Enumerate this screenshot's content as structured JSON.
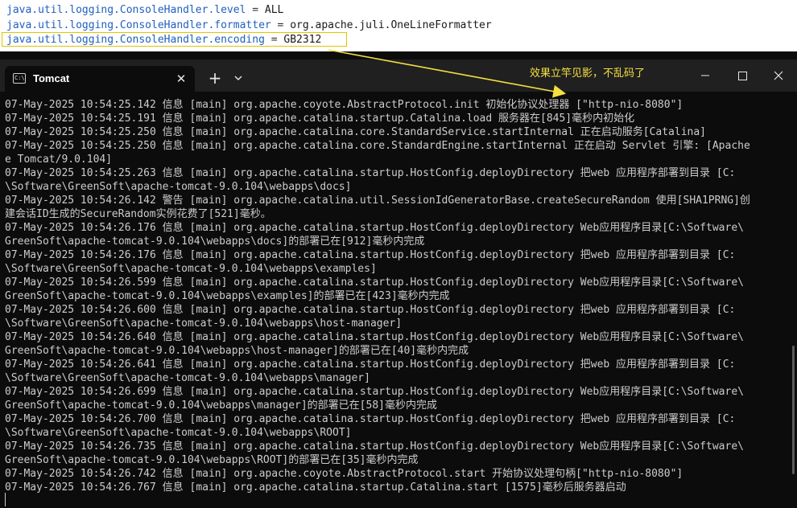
{
  "config_lines": [
    {
      "key": "java.util.logging.ConsoleHandler.level",
      "op": " = ",
      "value": "ALL"
    },
    {
      "key": "java.util.logging.ConsoleHandler.formatter",
      "op": " = ",
      "value": "org.apache.juli.OneLineFormatter"
    },
    {
      "key": "java.util.logging.ConsoleHandler.encoding",
      "op": " = ",
      "value": "GB2312"
    }
  ],
  "annotation": {
    "text": "效果立竿见影，不乱码了",
    "color": "#f5e040"
  },
  "tab": {
    "title": "Tomcat",
    "icon": "terminal-icon",
    "icon_label": "C:\\"
  },
  "window_buttons": [
    "minimize-icon",
    "maximize-icon",
    "close-icon"
  ],
  "console_lines": [
    "07-May-2025 10:54:25.142 信息 [main] org.apache.coyote.AbstractProtocol.init 初始化协议处理器 [\"http-nio-8080\"]",
    "07-May-2025 10:54:25.191 信息 [main] org.apache.catalina.startup.Catalina.load 服务器在[845]毫秒内初始化",
    "07-May-2025 10:54:25.250 信息 [main] org.apache.catalina.core.StandardService.startInternal 正在启动服务[Catalina]",
    "07-May-2025 10:54:25.250 信息 [main] org.apache.catalina.core.StandardEngine.startInternal 正在启动 Servlet 引擎: [Apache",
    "e Tomcat/9.0.104]",
    "07-May-2025 10:54:25.263 信息 [main] org.apache.catalina.startup.HostConfig.deployDirectory 把web 应用程序部署到目录 [C:",
    "\\Software\\GreenSoft\\apache-tomcat-9.0.104\\webapps\\docs]",
    "07-May-2025 10:54:26.142 警告 [main] org.apache.catalina.util.SessionIdGeneratorBase.createSecureRandom 使用[SHA1PRNG]创",
    "建会话ID生成的SecureRandom实例花费了[521]毫秒。",
    "07-May-2025 10:54:26.176 信息 [main] org.apache.catalina.startup.HostConfig.deployDirectory Web应用程序目录[C:\\Software\\",
    "GreenSoft\\apache-tomcat-9.0.104\\webapps\\docs]的部署已在[912]毫秒内完成",
    "07-May-2025 10:54:26.176 信息 [main] org.apache.catalina.startup.HostConfig.deployDirectory 把web 应用程序部署到目录 [C:",
    "\\Software\\GreenSoft\\apache-tomcat-9.0.104\\webapps\\examples]",
    "07-May-2025 10:54:26.599 信息 [main] org.apache.catalina.startup.HostConfig.deployDirectory Web应用程序目录[C:\\Software\\",
    "GreenSoft\\apache-tomcat-9.0.104\\webapps\\examples]的部署已在[423]毫秒内完成",
    "07-May-2025 10:54:26.600 信息 [main] org.apache.catalina.startup.HostConfig.deployDirectory 把web 应用程序部署到目录 [C:",
    "\\Software\\GreenSoft\\apache-tomcat-9.0.104\\webapps\\host-manager]",
    "07-May-2025 10:54:26.640 信息 [main] org.apache.catalina.startup.HostConfig.deployDirectory Web应用程序目录[C:\\Software\\",
    "GreenSoft\\apache-tomcat-9.0.104\\webapps\\host-manager]的部署已在[40]毫秒内完成",
    "07-May-2025 10:54:26.641 信息 [main] org.apache.catalina.startup.HostConfig.deployDirectory 把web 应用程序部署到目录 [C:",
    "\\Software\\GreenSoft\\apache-tomcat-9.0.104\\webapps\\manager]",
    "07-May-2025 10:54:26.699 信息 [main] org.apache.catalina.startup.HostConfig.deployDirectory Web应用程序目录[C:\\Software\\",
    "GreenSoft\\apache-tomcat-9.0.104\\webapps\\manager]的部署已在[58]毫秒内完成",
    "07-May-2025 10:54:26.700 信息 [main] org.apache.catalina.startup.HostConfig.deployDirectory 把web 应用程序部署到目录 [C:",
    "\\Software\\GreenSoft\\apache-tomcat-9.0.104\\webapps\\ROOT]",
    "07-May-2025 10:54:26.735 信息 [main] org.apache.catalina.startup.HostConfig.deployDirectory Web应用程序目录[C:\\Software\\",
    "GreenSoft\\apache-tomcat-9.0.104\\webapps\\ROOT]的部署已在[35]毫秒内完成",
    "07-May-2025 10:54:26.742 信息 [main] org.apache.coyote.AbstractProtocol.start 开始协议处理句柄[\"http-nio-8080\"]",
    "07-May-2025 10:54:26.767 信息 [main] org.apache.catalina.startup.Catalina.start [1575]毫秒后服务器启动"
  ]
}
